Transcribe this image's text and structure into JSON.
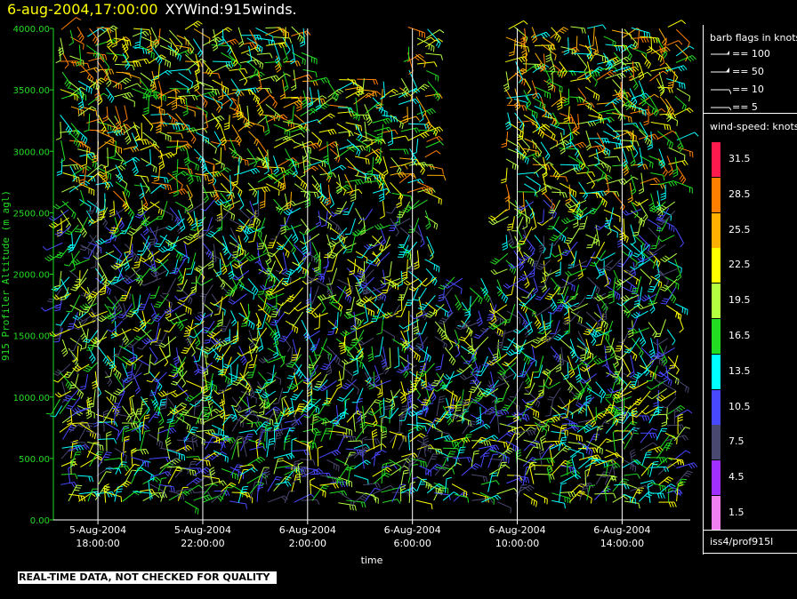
{
  "header": {
    "date_label": "6-aug-2004,17:00:00",
    "title_label": "XYWind:915winds."
  },
  "legend": {
    "barb_title": "barb flags in knots",
    "barb_flags": [
      {
        "label": "== 100",
        "value": 100
      },
      {
        "label": "== 50",
        "value": 50
      },
      {
        "label": "== 10",
        "value": 10
      },
      {
        "label": "== 5",
        "value": 5
      }
    ],
    "speed_title": "wind-speed: knots",
    "speed_scale": [
      {
        "label": "31.5",
        "color": "#ff1a4d"
      },
      {
        "label": "28.5",
        "color": "#ff8000"
      },
      {
        "label": "25.5",
        "color": "#ffb000"
      },
      {
        "label": "22.5",
        "color": "#ffff00"
      },
      {
        "label": "19.5",
        "color": "#b4ff40"
      },
      {
        "label": "16.5",
        "color": "#22dd22"
      },
      {
        "label": "13.5",
        "color": "#00ffff"
      },
      {
        "label": "10.5",
        "color": "#4848ff"
      },
      {
        "label": "7.5",
        "color": "#484870"
      },
      {
        "label": "4.5",
        "color": "#a030ff"
      },
      {
        "label": "1.5",
        "color": "#f080f0"
      }
    ],
    "station": "iss4/prof915l"
  },
  "disclaimer": "REAL-TIME DATA, NOT CHECKED FOR QUALITY",
  "chart_data": {
    "type": "wind-barb time-height plot",
    "title": "XYWind:915winds.",
    "ylabel": "915 Profiler Altitude (m agl)",
    "xlabel": "time",
    "ylim": [
      0,
      4000
    ],
    "xlim_hours": [
      16.3,
      40.6
    ],
    "y_ticks": [
      "0.00",
      "500.00",
      "1000.00",
      "1500.00",
      "2000.00",
      "2500.00",
      "3000.00",
      "3500.00",
      "4000.00"
    ],
    "y_tick_values": [
      0,
      500,
      1000,
      1500,
      2000,
      2500,
      3000,
      3500,
      4000
    ],
    "x_ticks": [
      {
        "date": "5-Aug-2004",
        "time": "18:00:00",
        "hours": 18
      },
      {
        "date": "5-Aug-2004",
        "time": "22:00:00",
        "hours": 22
      },
      {
        "date": "6-Aug-2004",
        "time": "2:00:00",
        "hours": 26
      },
      {
        "date": "6-Aug-2004",
        "time": "6:00:00",
        "hours": 30
      },
      {
        "date": "6-Aug-2004",
        "time": "10:00:00",
        "hours": 34
      },
      {
        "date": "6-Aug-2004",
        "time": "14:00:00",
        "hours": 38
      }
    ],
    "grid": "vertical lines at x ticks",
    "legend_placement": "right",
    "speed_units": "knots"
  }
}
